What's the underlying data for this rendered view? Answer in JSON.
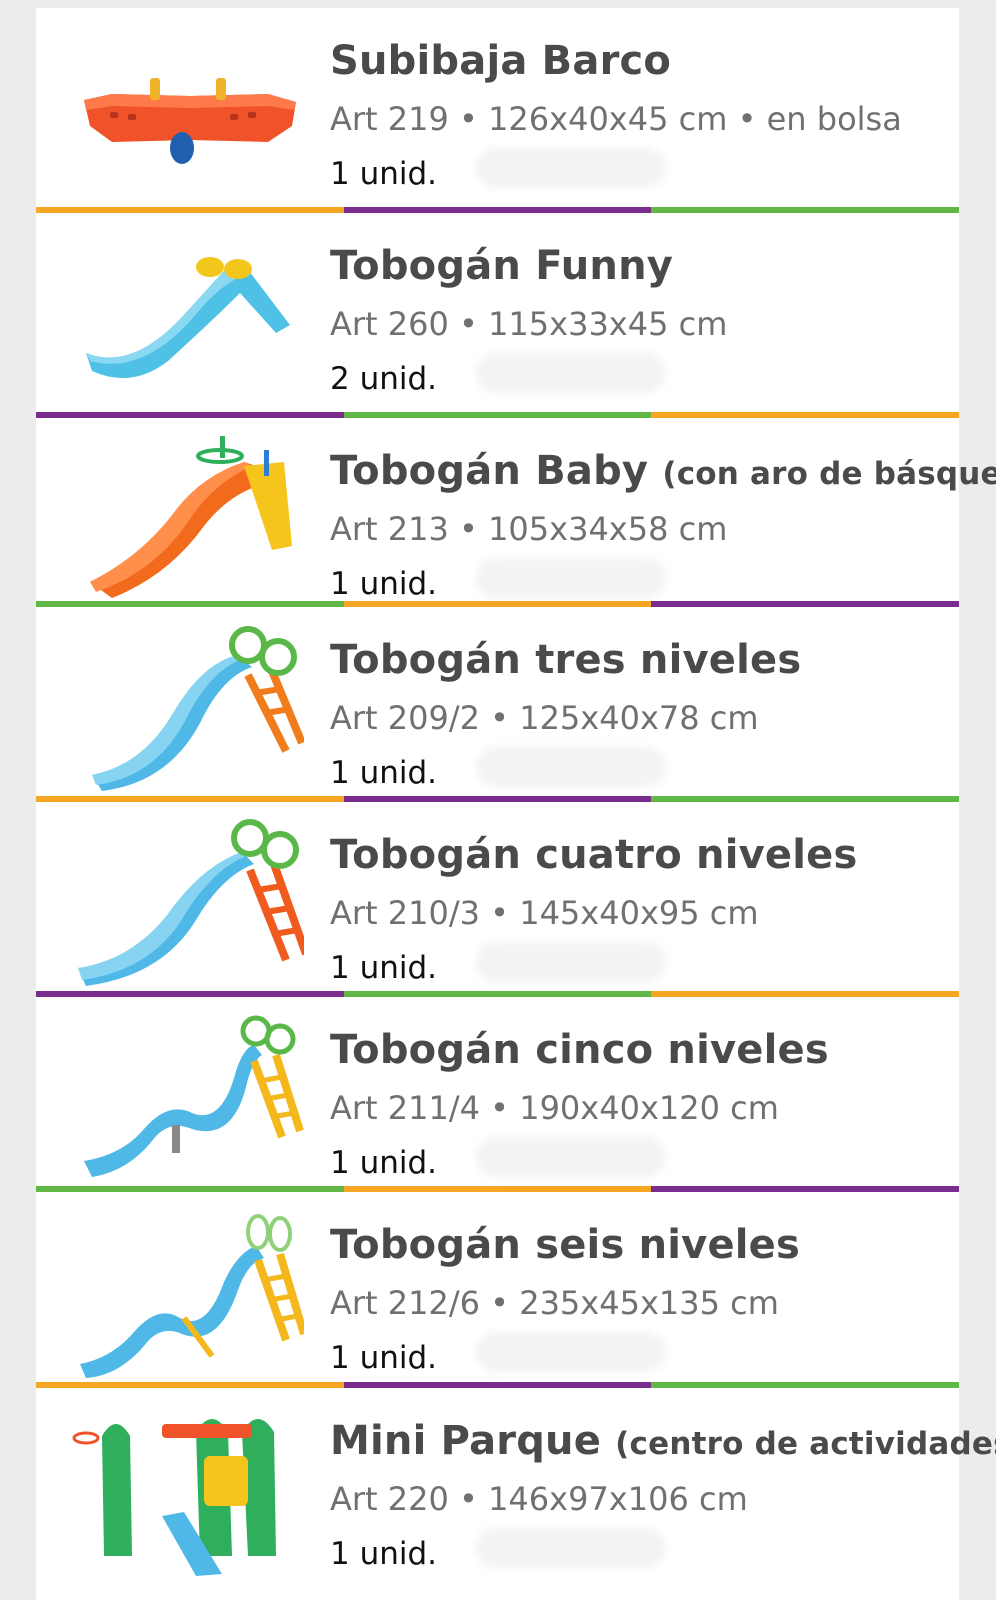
{
  "colors": {
    "orange": "#f5a623",
    "purple": "#7b2d8e",
    "green": "#62b846"
  },
  "products": [
    {
      "title": "Subibaja Barco",
      "subtitle": "",
      "specs": "Art 219 • 126x40x45 cm • en bolsa",
      "qty": "1 unid.",
      "icon": "seesaw-boat-icon",
      "divider": [
        "orange",
        "purple",
        "green"
      ]
    },
    {
      "title": "Tobogán Funny",
      "subtitle": "",
      "specs": "Art 260 • 115x33x45 cm",
      "qty": "2 unid.",
      "icon": "slide-icon",
      "divider": [
        "purple",
        "green",
        "orange"
      ]
    },
    {
      "title": "Tobogán Baby",
      "subtitle": "(con aro de básquet)",
      "specs": "Art 213 • 105x34x58 cm",
      "qty": "1 unid.",
      "icon": "slide-basketball-icon",
      "divider": [
        "green",
        "orange",
        "purple"
      ]
    },
    {
      "title": "Tobogán tres niveles",
      "subtitle": "",
      "specs": "Art 209/2 • 125x40x78 cm",
      "qty": "1 unid.",
      "icon": "slide-ladder-icon",
      "divider": [
        "orange",
        "purple",
        "green"
      ]
    },
    {
      "title": "Tobogán cuatro niveles",
      "subtitle": "",
      "specs": "Art 210/3 • 145x40x95 cm",
      "qty": "1 unid.",
      "icon": "slide-ladder-icon",
      "divider": [
        "purple",
        "green",
        "orange"
      ]
    },
    {
      "title": "Tobogán cinco niveles",
      "subtitle": "",
      "specs": "Art 211/4 • 190x40x120 cm",
      "qty": "1 unid.",
      "icon": "slide-ladder-icon",
      "divider": [
        "green",
        "orange",
        "purple"
      ]
    },
    {
      "title": "Tobogán seis niveles",
      "subtitle": "",
      "specs": "Art 212/6 • 235x45x135 cm",
      "qty": "1 unid.",
      "icon": "slide-ladder-icon",
      "divider": [
        "orange",
        "purple",
        "green"
      ]
    },
    {
      "title": "Mini Parque",
      "subtitle": "(centro de actividades)",
      "specs": "Art 220 • 146x97x106 cm",
      "qty": "1 unid.",
      "icon": "activity-center-icon",
      "divider": []
    }
  ]
}
